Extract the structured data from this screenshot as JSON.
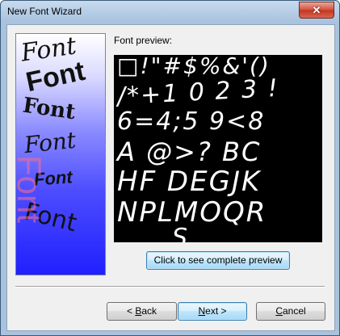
{
  "window": {
    "title": "New Font Wizard",
    "close_glyph": "✕"
  },
  "side_image": {
    "word": "Font"
  },
  "preview": {
    "label": "Font preview:",
    "lines": [
      "□!\"#$%&'()",
      "/*+1 0 2 3 !",
      "6=4;5 9<8",
      "A @>? BC",
      "HF DEGJK",
      "NPLMOQR",
      "S"
    ]
  },
  "buttons": {
    "complete_preview": "Click to see complete preview",
    "back": {
      "prefix": "< ",
      "mnemonic": "B",
      "rest": "ack"
    },
    "next": {
      "mnemonic": "N",
      "rest": "ext >"
    },
    "cancel": {
      "mnemonic": "C",
      "rest": "ancel"
    }
  }
}
